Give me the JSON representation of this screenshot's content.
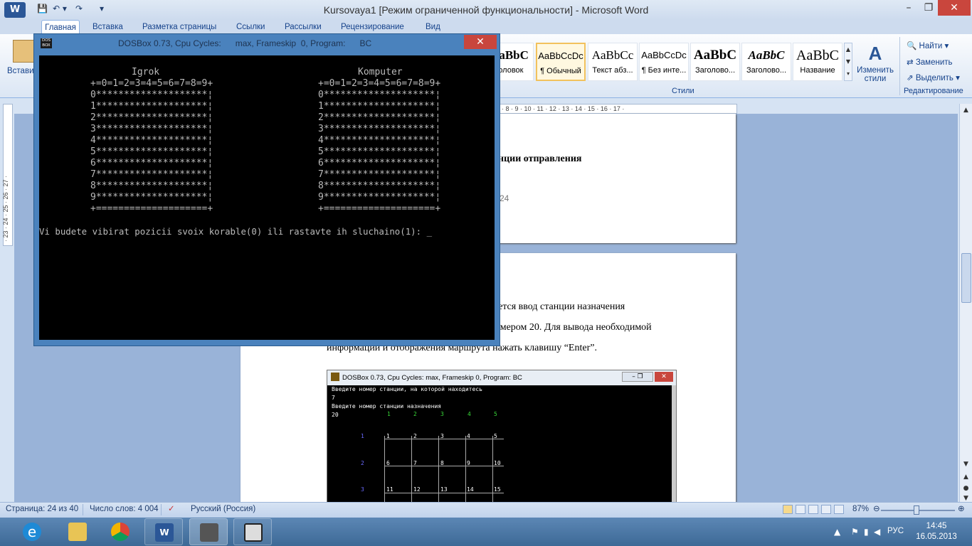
{
  "word": {
    "title": "Kursovaya1 [Режим ограниченной функциональности] - Microsoft Word",
    "app_icon": "W",
    "qat_icons": [
      "save-icon",
      "undo-icon",
      "redo-icon",
      "customize-icon"
    ],
    "tabs": [
      "Главная",
      "Вставка",
      "Разметка страницы",
      "Ссылки",
      "Рассылки",
      "Рецензирование",
      "Вид"
    ],
    "paste_label": "Вставить",
    "styles": [
      {
        "sample": "AaBbC",
        "name": "головок"
      },
      {
        "sample": "AaBbCcDc",
        "name": "¶ Обычный"
      },
      {
        "sample": "AaBbCc",
        "name": "Текст абз..."
      },
      {
        "sample": "AaBbCcDc",
        "name": "¶ Без инте..."
      },
      {
        "sample": "AaBbC",
        "name": "Заголово..."
      },
      {
        "sample": "AaBbC",
        "name": "Заголово..."
      },
      {
        "sample": "AaBbC",
        "name": "Название"
      }
    ],
    "change_styles": "Изменить стили",
    "styles_group": "Стили",
    "edit_group": "Редактирование",
    "edit_items": [
      "Найти",
      "Заменить",
      "Выделить"
    ],
    "ruler_h": "· 8 · 9 · 10 · 11 · 12 · 13 · 14 · 15 · 16 · 17 ·",
    "ruler_v": "· 23 · 24 · 25 · 26 · 27 ·",
    "page1_lines": [
      "нции отправления",
      "24"
    ],
    "page2_lines": [
      "ется  ввод станции  назначения",
      "омером 20. Для вывода необходимой",
      "информации и отображения маршрута нажать клавишу “Enter”."
    ],
    "status": {
      "page": "Страница: 24 из 40",
      "words": "Число слов: 4 004",
      "lang": "Русский (Россия)",
      "zoom": "87%"
    }
  },
  "embedded_shot": {
    "title": "DOSBox 0.73, Cpu Cycles:      max, Frameskip  0, Program:      BC",
    "lines": [
      "Введите номер станции, на которой находитесь",
      "7",
      "Введите номер станции назначения",
      "20"
    ],
    "header_cols": [
      "1",
      "2",
      "3",
      "4",
      "5"
    ],
    "row_labels": [
      "1",
      "2",
      "3"
    ],
    "cells": [
      "1",
      "2",
      "3",
      "4",
      "5",
      "6",
      "7",
      "8",
      "9",
      "10",
      "11",
      "12",
      "13",
      "14",
      "15"
    ]
  },
  "dosbox": {
    "title": "DOSBox 0.73, Cpu Cycles:      max, Frameskip  0, Program:      BC",
    "icon_text": "DOS BOX",
    "player_label": "Igrok",
    "computer_label": "Komputer",
    "header_row": "+=0=1=2=3=4=5=6=7=8=9+",
    "rows": [
      "0********************¦",
      "1********************¦",
      "2********************¦",
      "3********************¦",
      "4********************¦",
      "5********************¦",
      "6********************¦",
      "7********************¦",
      "8********************¦",
      "9********************¦"
    ],
    "footer_row": "+====================+",
    "prompt": "Vi budete vibirat pozicii svoix korable(0) ili rastavte ih sluchaino(1): _"
  },
  "taskbar": {
    "apps": [
      "ie-icon",
      "explorer-icon",
      "chrome-icon",
      "word-icon",
      "dosbox-icon",
      "borland-icon"
    ],
    "lang": "РУС",
    "time": "14:45",
    "date": "16.05.2013"
  }
}
